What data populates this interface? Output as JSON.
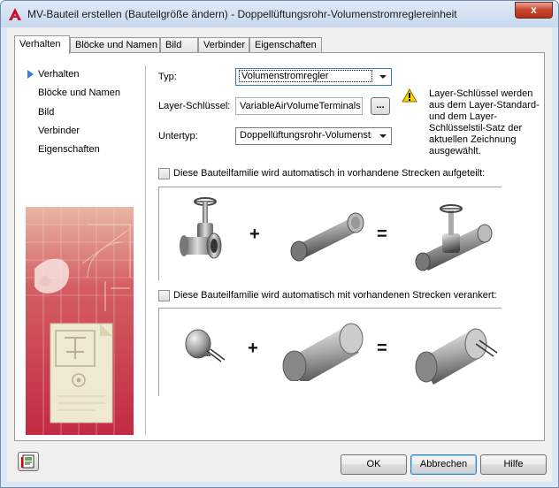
{
  "window": {
    "title": "MV-Bauteil erstellen (Bauteilgröße ändern) - Doppellüftungsrohr-Volumenstromreglereinheit",
    "close_label": "x",
    "app_icon": "autocad-red-a-icon"
  },
  "tabs": [
    {
      "label": "Verhalten",
      "active": true
    },
    {
      "label": "Blöcke und Namen",
      "active": false
    },
    {
      "label": "Bild",
      "active": false
    },
    {
      "label": "Verbinder",
      "active": false
    },
    {
      "label": "Eigenschaften",
      "active": false
    }
  ],
  "nav": {
    "items": [
      {
        "label": "Verhalten",
        "selected": true
      },
      {
        "label": "Blöcke und Namen",
        "selected": false
      },
      {
        "label": "Bild",
        "selected": false
      },
      {
        "label": "Verbinder",
        "selected": false
      },
      {
        "label": "Eigenschaften",
        "selected": false
      }
    ]
  },
  "form": {
    "typ_label": "Typ:",
    "typ_value": "Volumenstromregler",
    "layer_label": "Layer-Schlüssel:",
    "layer_value": "VariableAirVolumeTerminals",
    "browse_label": "...",
    "untertyp_label": "Untertyp:",
    "untertyp_value": "Doppellüftungsrohr-Volumenstro"
  },
  "warning": {
    "icon": "warning-triangle-icon",
    "text": "Layer-Schlüssel werden aus dem Layer-Standard- und dem Layer-Schlüsselstil-Satz der aktuellen Zeichnung ausgewählt."
  },
  "options": {
    "split_label": "Diese Bauteilfamilie wird automatisch in vorhandene Strecken aufgeteilt:",
    "split_checked": false,
    "anchor_label": "Diese Bauteilfamilie wird automatisch mit vorhandenen Strecken verankert:",
    "anchor_checked": false,
    "plus": "+",
    "equals": "="
  },
  "buttons": {
    "ok": "OK",
    "cancel": "Abbrechen",
    "help": "Hilfe",
    "help_icon": "help-book-icon"
  },
  "colors": {
    "accent": "#3b7ee6",
    "art_red": "#c8323f",
    "title_bg": "#dbe7f4"
  }
}
